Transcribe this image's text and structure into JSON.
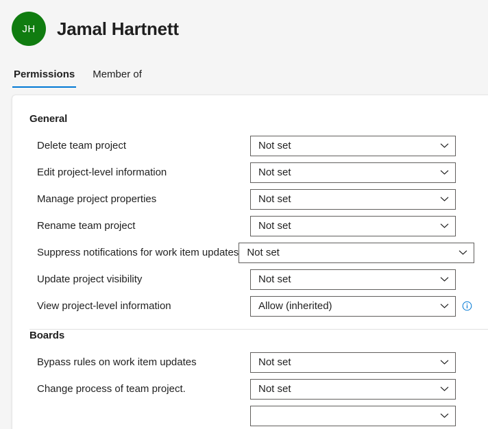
{
  "header": {
    "avatar_initials": "JH",
    "avatar_color": "#107c10",
    "display_name": "Jamal Hartnett"
  },
  "tabs": [
    {
      "label": "Permissions",
      "active": true
    },
    {
      "label": "Member of",
      "active": false
    }
  ],
  "accent_color": "#0078d4",
  "icons": {
    "chevron": "chevron-down-icon",
    "info": "info-icon"
  },
  "sections": [
    {
      "title": "General",
      "rows": [
        {
          "label": "Delete team project",
          "value": "Not set",
          "wide": false,
          "info": false
        },
        {
          "label": "Edit project-level information",
          "value": "Not set",
          "wide": false,
          "info": false
        },
        {
          "label": "Manage project properties",
          "value": "Not set",
          "wide": false,
          "info": false
        },
        {
          "label": "Rename team project",
          "value": "Not set",
          "wide": false,
          "info": false
        },
        {
          "label": "Suppress notifications for work item updates",
          "value": "Not set",
          "wide": true,
          "info": false
        },
        {
          "label": "Update project visibility",
          "value": "Not set",
          "wide": false,
          "info": false
        },
        {
          "label": "View project-level information",
          "value": "Allow (inherited)",
          "wide": false,
          "info": true
        }
      ]
    },
    {
      "title": "Boards",
      "rows": [
        {
          "label": "Bypass rules on work item updates",
          "value": "Not set",
          "wide": false,
          "info": false
        },
        {
          "label": "Change process of team project.",
          "value": "Not set",
          "wide": false,
          "info": false
        },
        {
          "label": "",
          "value": "",
          "wide": false,
          "info": false
        }
      ]
    }
  ]
}
